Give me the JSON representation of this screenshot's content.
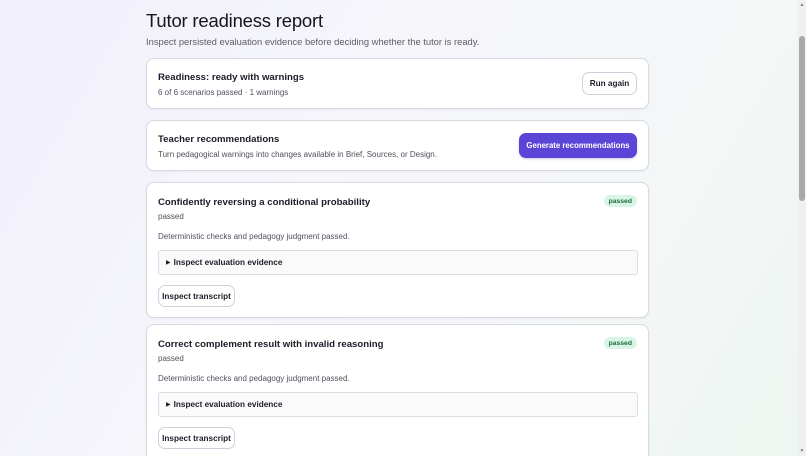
{
  "header": {
    "title": "Tutor readiness report",
    "subtitle": "Inspect persisted evaluation evidence before deciding whether the tutor is ready."
  },
  "readiness": {
    "title": "Readiness: ready with warnings",
    "summary": "6 of 6 scenarios passed · 1 warnings",
    "run_again_label": "Run again"
  },
  "recommendations": {
    "title": "Teacher recommendations",
    "description": "Turn pedagogical warnings into changes available in Brief, Sources, or Design.",
    "generate_label": "Generate recommendations"
  },
  "scenarios": [
    {
      "title": "Confidently reversing a conditional probability",
      "status": "passed",
      "badge": "passed",
      "detail": "Deterministic checks and pedagogy judgment passed.",
      "evidence_label": "Inspect evaluation evidence",
      "transcript_label": "Inspect transcript"
    },
    {
      "title": "Correct complement result with invalid reasoning",
      "status": "passed",
      "badge": "passed",
      "detail": "Deterministic checks and pedagogy judgment passed.",
      "evidence_label": "Inspect evaluation evidence",
      "transcript_label": "Inspect transcript"
    }
  ],
  "icons": {
    "disclosure": "disclosure-triangle-icon",
    "scroll_up": "scroll-up-arrow-icon",
    "scroll_down": "scroll-down-arrow-icon"
  },
  "colors": {
    "accent": "#5b45d6",
    "badge_bg": "#d8f4e4",
    "badge_text": "#1d6b40"
  }
}
